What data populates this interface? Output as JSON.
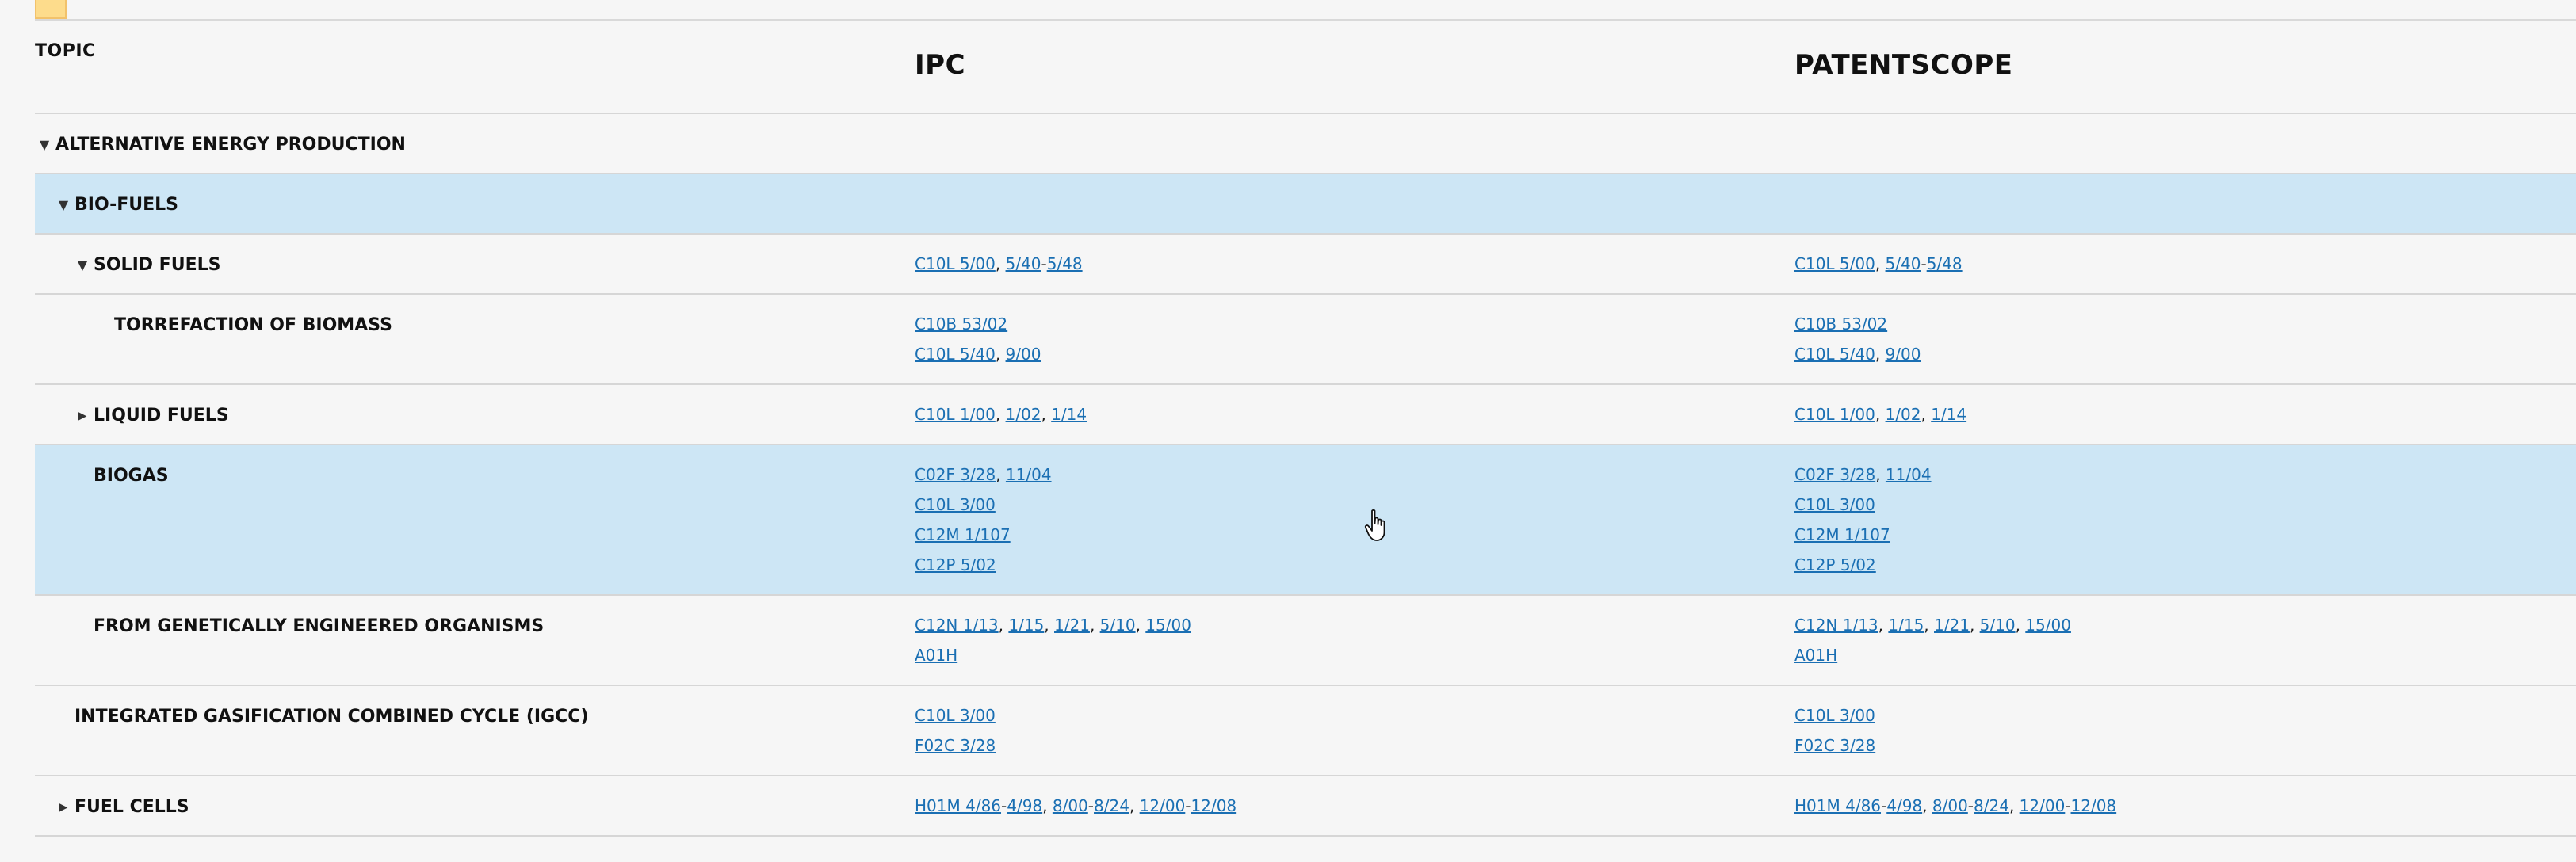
{
  "headers": {
    "topic": "TOPIC",
    "ipc": "IPC",
    "patentscope": "PATENTSCOPE"
  },
  "rows": [
    {
      "label": "ALTERNATIVE ENERGY PRODUCTION",
      "toggle": "expanded",
      "indent": 0,
      "selected": false,
      "ipc": [],
      "patentscope": []
    },
    {
      "label": "BIO-FUELS",
      "toggle": "expanded",
      "indent": 1,
      "selected": true,
      "ipc": [],
      "patentscope": []
    },
    {
      "label": "SOLID FUELS",
      "toggle": "expanded",
      "indent": 2,
      "selected": false,
      "ipc": [
        [
          "C10L 5/00",
          ", ",
          "5/40",
          "-",
          "5/48"
        ]
      ],
      "patentscope": [
        [
          "C10L 5/00",
          ", ",
          "5/40",
          "-",
          "5/48"
        ]
      ]
    },
    {
      "label": "TORREFACTION OF BIOMASS",
      "toggle": "none",
      "indent": 3,
      "selected": false,
      "ipc": [
        [
          "C10B 53/02"
        ],
        [
          "C10L 5/40",
          ", ",
          "9/00"
        ]
      ],
      "patentscope": [
        [
          "C10B 53/02"
        ],
        [
          "C10L 5/40",
          ", ",
          "9/00"
        ]
      ]
    },
    {
      "label": "LIQUID FUELS",
      "toggle": "collapsed",
      "indent": 2,
      "selected": false,
      "ipc": [
        [
          "C10L 1/00",
          ", ",
          "1/02",
          ", ",
          "1/14"
        ]
      ],
      "patentscope": [
        [
          "C10L 1/00",
          ", ",
          "1/02",
          ", ",
          "1/14"
        ]
      ]
    },
    {
      "label": "BIOGAS",
      "toggle": "none",
      "indent": 2,
      "selected": true,
      "ipc": [
        [
          "C02F 3/28",
          ", ",
          "11/04"
        ],
        [
          "C10L 3/00"
        ],
        [
          "C12M 1/107"
        ],
        [
          "C12P 5/02"
        ]
      ],
      "patentscope": [
        [
          "C02F 3/28",
          ", ",
          "11/04"
        ],
        [
          "C10L 3/00"
        ],
        [
          "C12M 1/107"
        ],
        [
          "C12P 5/02"
        ]
      ]
    },
    {
      "label": "FROM GENETICALLY ENGINEERED ORGANISMS",
      "toggle": "none",
      "indent": 2,
      "selected": false,
      "ipc": [
        [
          "C12N 1/13",
          ", ",
          "1/15",
          ", ",
          "1/21",
          ", ",
          "5/10",
          ", ",
          "15/00"
        ],
        [
          "A01H"
        ]
      ],
      "patentscope": [
        [
          "C12N 1/13",
          ", ",
          "1/15",
          ", ",
          "1/21",
          ", ",
          "5/10",
          ", ",
          "15/00"
        ],
        [
          "A01H"
        ]
      ]
    },
    {
      "label": "INTEGRATED GASIFICATION COMBINED CYCLE (IGCC)",
      "toggle": "none",
      "indent": 1,
      "selected": false,
      "ipc": [
        [
          "C10L 3/00"
        ],
        [
          "F02C 3/28"
        ]
      ],
      "patentscope": [
        [
          "C10L 3/00"
        ],
        [
          "F02C 3/28"
        ]
      ]
    },
    {
      "label": "FUEL CELLS",
      "toggle": "collapsed",
      "indent": 1,
      "selected": false,
      "ipc": [
        [
          "H01M 4/86",
          "-",
          "4/98",
          ", ",
          "8/00",
          "-",
          "8/24",
          ", ",
          "12/00",
          "-",
          "12/08"
        ]
      ],
      "patentscope": [
        [
          "H01M 4/86",
          "-",
          "4/98",
          ", ",
          "8/00",
          "-",
          "8/24",
          ", ",
          "12/00",
          "-",
          "12/08"
        ]
      ]
    }
  ],
  "icons": {
    "expanded": "triangle-down-icon",
    "collapsed": "triangle-right-icon",
    "cursor": "hand-pointer-icon"
  },
  "colors": {
    "link": "#1a6fb3",
    "selected_row": "#cde6f5",
    "background": "#f6f6f6"
  }
}
